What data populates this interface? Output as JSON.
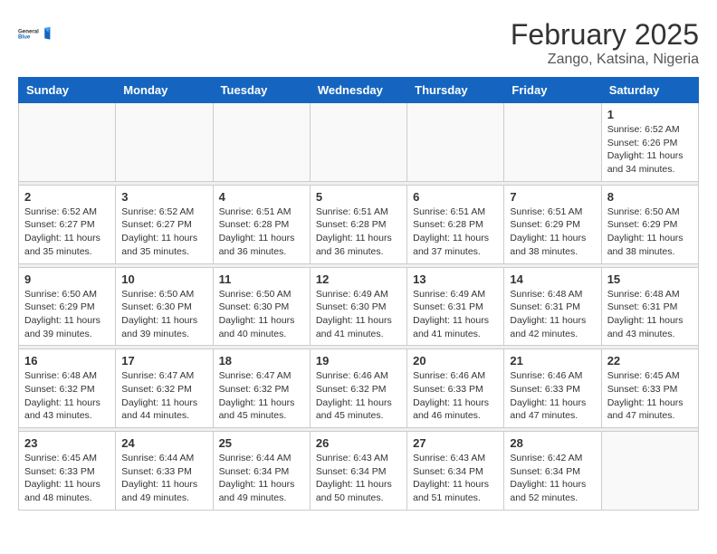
{
  "header": {
    "logo_general": "General",
    "logo_blue": "Blue",
    "month_title": "February 2025",
    "location": "Zango, Katsina, Nigeria"
  },
  "days_of_week": [
    "Sunday",
    "Monday",
    "Tuesday",
    "Wednesday",
    "Thursday",
    "Friday",
    "Saturday"
  ],
  "weeks": [
    [
      {
        "day": null
      },
      {
        "day": null
      },
      {
        "day": null
      },
      {
        "day": null
      },
      {
        "day": null
      },
      {
        "day": null
      },
      {
        "day": "1",
        "sunrise": "6:52 AM",
        "sunset": "6:26 PM",
        "daylight": "11 hours and 34 minutes."
      }
    ],
    [
      {
        "day": "2",
        "sunrise": "6:52 AM",
        "sunset": "6:27 PM",
        "daylight": "11 hours and 35 minutes."
      },
      {
        "day": "3",
        "sunrise": "6:52 AM",
        "sunset": "6:27 PM",
        "daylight": "11 hours and 35 minutes."
      },
      {
        "day": "4",
        "sunrise": "6:51 AM",
        "sunset": "6:28 PM",
        "daylight": "11 hours and 36 minutes."
      },
      {
        "day": "5",
        "sunrise": "6:51 AM",
        "sunset": "6:28 PM",
        "daylight": "11 hours and 36 minutes."
      },
      {
        "day": "6",
        "sunrise": "6:51 AM",
        "sunset": "6:28 PM",
        "daylight": "11 hours and 37 minutes."
      },
      {
        "day": "7",
        "sunrise": "6:51 AM",
        "sunset": "6:29 PM",
        "daylight": "11 hours and 38 minutes."
      },
      {
        "day": "8",
        "sunrise": "6:50 AM",
        "sunset": "6:29 PM",
        "daylight": "11 hours and 38 minutes."
      }
    ],
    [
      {
        "day": "9",
        "sunrise": "6:50 AM",
        "sunset": "6:29 PM",
        "daylight": "11 hours and 39 minutes."
      },
      {
        "day": "10",
        "sunrise": "6:50 AM",
        "sunset": "6:30 PM",
        "daylight": "11 hours and 39 minutes."
      },
      {
        "day": "11",
        "sunrise": "6:50 AM",
        "sunset": "6:30 PM",
        "daylight": "11 hours and 40 minutes."
      },
      {
        "day": "12",
        "sunrise": "6:49 AM",
        "sunset": "6:30 PM",
        "daylight": "11 hours and 41 minutes."
      },
      {
        "day": "13",
        "sunrise": "6:49 AM",
        "sunset": "6:31 PM",
        "daylight": "11 hours and 41 minutes."
      },
      {
        "day": "14",
        "sunrise": "6:48 AM",
        "sunset": "6:31 PM",
        "daylight": "11 hours and 42 minutes."
      },
      {
        "day": "15",
        "sunrise": "6:48 AM",
        "sunset": "6:31 PM",
        "daylight": "11 hours and 43 minutes."
      }
    ],
    [
      {
        "day": "16",
        "sunrise": "6:48 AM",
        "sunset": "6:32 PM",
        "daylight": "11 hours and 43 minutes."
      },
      {
        "day": "17",
        "sunrise": "6:47 AM",
        "sunset": "6:32 PM",
        "daylight": "11 hours and 44 minutes."
      },
      {
        "day": "18",
        "sunrise": "6:47 AM",
        "sunset": "6:32 PM",
        "daylight": "11 hours and 45 minutes."
      },
      {
        "day": "19",
        "sunrise": "6:46 AM",
        "sunset": "6:32 PM",
        "daylight": "11 hours and 45 minutes."
      },
      {
        "day": "20",
        "sunrise": "6:46 AM",
        "sunset": "6:33 PM",
        "daylight": "11 hours and 46 minutes."
      },
      {
        "day": "21",
        "sunrise": "6:46 AM",
        "sunset": "6:33 PM",
        "daylight": "11 hours and 47 minutes."
      },
      {
        "day": "22",
        "sunrise": "6:45 AM",
        "sunset": "6:33 PM",
        "daylight": "11 hours and 47 minutes."
      }
    ],
    [
      {
        "day": "23",
        "sunrise": "6:45 AM",
        "sunset": "6:33 PM",
        "daylight": "11 hours and 48 minutes."
      },
      {
        "day": "24",
        "sunrise": "6:44 AM",
        "sunset": "6:33 PM",
        "daylight": "11 hours and 49 minutes."
      },
      {
        "day": "25",
        "sunrise": "6:44 AM",
        "sunset": "6:34 PM",
        "daylight": "11 hours and 49 minutes."
      },
      {
        "day": "26",
        "sunrise": "6:43 AM",
        "sunset": "6:34 PM",
        "daylight": "11 hours and 50 minutes."
      },
      {
        "day": "27",
        "sunrise": "6:43 AM",
        "sunset": "6:34 PM",
        "daylight": "11 hours and 51 minutes."
      },
      {
        "day": "28",
        "sunrise": "6:42 AM",
        "sunset": "6:34 PM",
        "daylight": "11 hours and 52 minutes."
      },
      {
        "day": null
      }
    ]
  ]
}
